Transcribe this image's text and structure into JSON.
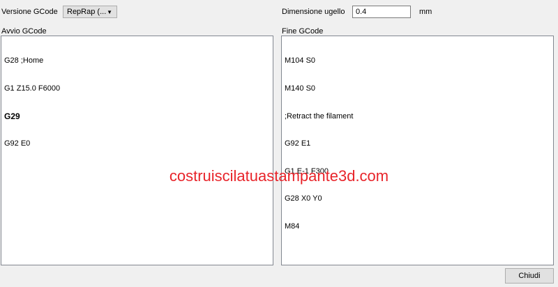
{
  "gcode_flavor": {
    "label": "Versione GCode",
    "selected": "RepRap (..."
  },
  "nozzle": {
    "label": "Dimensione ugello",
    "value": "0.4",
    "unit": "mm"
  },
  "start_gcode": {
    "label": "Avvio GCode",
    "lines": [
      "G28 ;Home",
      "G1 Z15.0 F6000",
      "G29",
      "G92 E0"
    ]
  },
  "end_gcode": {
    "label": "Fine GCode",
    "lines": [
      "M104 S0",
      "M140 S0",
      ";Retract the filament",
      "G92 E1",
      "G1 E-1 F300",
      "G28 X0 Y0",
      "M84"
    ]
  },
  "watermark": "costruiscilatuastampante3d.com",
  "close_button": "Chiudi",
  "colors": {
    "watermark": "#e8242a",
    "background": "#f0f0f0"
  }
}
